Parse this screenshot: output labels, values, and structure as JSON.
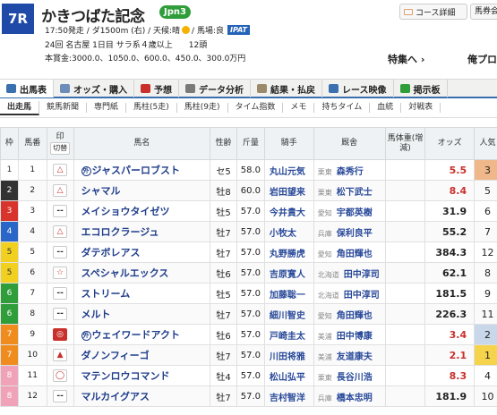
{
  "race": {
    "number": "7R",
    "name": "かきつばた記念",
    "grade": "Jpn3",
    "info1_a": "17:50発走 / ダ1500m (右) / 天候:晴",
    "info1_b": "/ 馬場:良",
    "ipat": "IPAT",
    "info2": "24回 名古屋 1日目 サラ系４歳以上　　12頭",
    "prize": "本賞金:3000.0、1050.0、600.0、450.0、300.0万円"
  },
  "header_buttons": {
    "course": "コース詳細",
    "ticket": "馬券会"
  },
  "links": {
    "feature": "特集へ ›",
    "favorite": "俺プロ"
  },
  "tabs": [
    {
      "label": "出馬表",
      "color": "#3a6fb0"
    },
    {
      "label": "オッズ・購入",
      "color": "#6b8db8"
    },
    {
      "label": "予想",
      "color": "#c9302c"
    },
    {
      "label": "データ分析",
      "color": "#7a7a7a"
    },
    {
      "label": "結果・払戻",
      "color": "#9a8a6a"
    },
    {
      "label": "レース映像",
      "color": "#3a6fb0"
    },
    {
      "label": "掲示板",
      "color": "#2e9d3a"
    }
  ],
  "subtabs": [
    "出走馬",
    "競馬新聞",
    "専門紙",
    "馬柱(5走)",
    "馬柱(9走)",
    "タイム指数",
    "メモ",
    "持ちタイム",
    "血統",
    "対戦表"
  ],
  "table_headers": {
    "waku": "枠",
    "umaban": "馬番",
    "mark": "印",
    "cut": "切替",
    "horse": "馬名",
    "sexage": "性齢",
    "weight": "斤量",
    "jockey": "騎手",
    "trainer": "厩舎",
    "bodyweight": "馬体重(増減)",
    "odds": "オッズ",
    "ninki": "人気"
  },
  "colors": {
    "waku": [
      "#ffffff",
      "#333333",
      "#d9342b",
      "#2a66c7",
      "#f2d020",
      "#2e9d3a",
      "#f08c1e",
      "#f0a3b8"
    ],
    "waku_text": [
      "#333333",
      "#ffffff",
      "#ffffff",
      "#ffffff",
      "#333333",
      "#ffffff",
      "#ffffff",
      "#ffffff"
    ],
    "odds_hi": "#c9302c",
    "ninki_bg": [
      "#f5d34a",
      "#c8d8ea",
      "#f0b88a"
    ]
  },
  "horses": [
    {
      "waku": "1",
      "uma": "1",
      "mark": "△",
      "mk": "tan",
      "pr": "外",
      "name": "ジャスパーロブスト",
      "sex": "セ5",
      "kin": "58.0",
      "jockey": "丸山元気",
      "loc": "栗東",
      "trainer": "森秀行",
      "bw": "",
      "odds": "5.5",
      "red": true,
      "ninki": "3",
      "nb": 2
    },
    {
      "waku": "2",
      "uma": "2",
      "mark": "△",
      "mk": "tan",
      "pr": "",
      "name": "シャマル",
      "sex": "牡8",
      "kin": "60.0",
      "jockey": "岩田望来",
      "loc": "栗東",
      "trainer": "松下武士",
      "bw": "",
      "odds": "8.4",
      "red": true,
      "ninki": "5",
      "nb": -1
    },
    {
      "waku": "3",
      "uma": "3",
      "mark": "--",
      "mk": "dash",
      "pr": "",
      "name": "メイショウタイゼツ",
      "sex": "牡5",
      "kin": "57.0",
      "jockey": "今井貴大",
      "loc": "愛知",
      "trainer": "宇都英樹",
      "bw": "",
      "odds": "31.9",
      "red": false,
      "ninki": "6",
      "nb": -1
    },
    {
      "waku": "4",
      "uma": "4",
      "mark": "△",
      "mk": "tan",
      "pr": "",
      "name": "エコロクラージュ",
      "sex": "牡7",
      "kin": "57.0",
      "jockey": "小牧太",
      "loc": "兵庫",
      "trainer": "保利良平",
      "bw": "",
      "odds": "55.2",
      "red": false,
      "ninki": "7",
      "nb": -1
    },
    {
      "waku": "5",
      "uma": "5",
      "mark": "--",
      "mk": "dash",
      "pr": "",
      "name": "ダテボレアス",
      "sex": "牡7",
      "kin": "57.0",
      "jockey": "丸野勝虎",
      "loc": "愛知",
      "trainer": "角田輝也",
      "bw": "",
      "odds": "384.3",
      "red": false,
      "ninki": "12",
      "nb": -1
    },
    {
      "waku": "5",
      "uma": "6",
      "mark": "☆",
      "mk": "osa",
      "pr": "",
      "name": "スペシャルエックス",
      "sex": "牡6",
      "kin": "57.0",
      "jockey": "吉原寛人",
      "loc": "北海道",
      "trainer": "田中淳司",
      "bw": "",
      "odds": "62.1",
      "red": false,
      "ninki": "8",
      "nb": -1
    },
    {
      "waku": "6",
      "uma": "7",
      "mark": "--",
      "mk": "dash",
      "pr": "",
      "name": "ストリーム",
      "sex": "牡5",
      "kin": "57.0",
      "jockey": "加藤聡一",
      "loc": "北海道",
      "trainer": "田中淳司",
      "bw": "",
      "odds": "181.5",
      "red": false,
      "ninki": "9",
      "nb": -1
    },
    {
      "waku": "6",
      "uma": "8",
      "mark": "--",
      "mk": "dash",
      "pr": "",
      "name": "メルト",
      "sex": "牡7",
      "kin": "57.0",
      "jockey": "細川智史",
      "loc": "愛知",
      "trainer": "角田輝也",
      "bw": "",
      "odds": "226.3",
      "red": false,
      "ninki": "11",
      "nb": -1
    },
    {
      "waku": "7",
      "uma": "9",
      "mark": "◎",
      "mk": "hon",
      "pr": "外",
      "name": "ウェイワードアクト",
      "sex": "牡6",
      "kin": "57.0",
      "jockey": "戸崎圭太",
      "loc": "美浦",
      "trainer": "田中博康",
      "bw": "",
      "odds": "3.4",
      "red": true,
      "ninki": "2",
      "nb": 1
    },
    {
      "waku": "7",
      "uma": "10",
      "mark": "▲",
      "mk": "ato",
      "pr": "",
      "name": "ダノンフィーゴ",
      "sex": "牡7",
      "kin": "57.0",
      "jockey": "川田将雅",
      "loc": "美浦",
      "trainer": "友道康夫",
      "bw": "",
      "odds": "2.1",
      "red": true,
      "ninki": "1",
      "nb": 0
    },
    {
      "waku": "8",
      "uma": "11",
      "mark": "◯",
      "mk": "tan",
      "pr": "",
      "name": "マテンロウコマンド",
      "sex": "牡4",
      "kin": "57.0",
      "jockey": "松山弘平",
      "loc": "栗東",
      "trainer": "長谷川浩",
      "bw": "",
      "odds": "8.3",
      "red": true,
      "ninki": "4",
      "nb": -1
    },
    {
      "waku": "8",
      "uma": "12",
      "mark": "--",
      "mk": "dash",
      "pr": "",
      "name": "マルカイグアス",
      "sex": "牡7",
      "kin": "57.0",
      "jockey": "吉村智洋",
      "loc": "兵庫",
      "trainer": "橋本忠明",
      "bw": "",
      "odds": "181.9",
      "red": false,
      "ninki": "10",
      "nb": -1
    }
  ]
}
